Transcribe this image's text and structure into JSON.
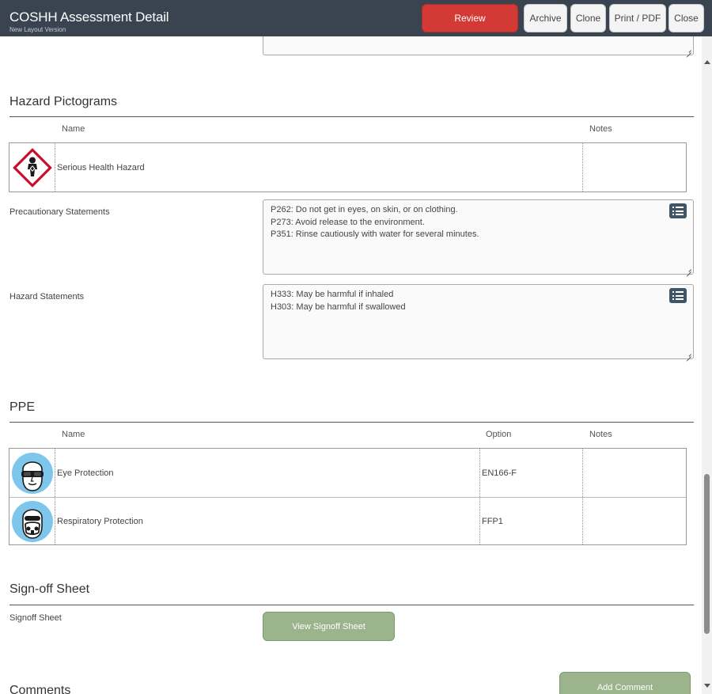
{
  "header": {
    "title": "COSHH Assessment Detail",
    "subtitle": "New Layout Version",
    "buttons": {
      "review": "Review",
      "archive": "Archive",
      "clone": "Clone",
      "print": "Print / PDF",
      "close": "Close"
    }
  },
  "hazard_pictograms": {
    "title": "Hazard Pictograms",
    "columns": {
      "name": "Name",
      "notes": "Notes"
    },
    "rows": [
      {
        "icon": "serious-health-hazard-icon",
        "name": "Serious Health Hazard",
        "notes": ""
      }
    ]
  },
  "precautionary": {
    "label": "Precautionary Statements",
    "lines": [
      "P262: Do not get in eyes, on skin, or on clothing.",
      "P273: Avoid release to the environment.",
      "P351: Rinse cautiously with water for several minutes."
    ]
  },
  "hazard_statements": {
    "label": "Hazard Statements",
    "lines": [
      "H333: May be harmful if inhaled",
      "H303: May be harmful if swallowed"
    ]
  },
  "ppe": {
    "title": "PPE",
    "columns": {
      "name": "Name",
      "option": "Option",
      "notes": "Notes"
    },
    "rows": [
      {
        "icon": "eye-protection-icon",
        "name": "Eye Protection",
        "option": "EN166-F",
        "notes": ""
      },
      {
        "icon": "respiratory-protection-icon",
        "name": "Respiratory Protection",
        "option": "FFP1",
        "notes": ""
      }
    ]
  },
  "signoff": {
    "title": "Sign-off Sheet",
    "label": "Signoff Sheet",
    "button": "View Signoff Sheet"
  },
  "comments": {
    "title": "Comments",
    "button": "Add Comment"
  },
  "colors": {
    "header_bg": "#3a4450",
    "review_button": "#d43a35",
    "green_button": "#9bb48c",
    "ppe_icon_bg": "#7fc6ec",
    "hazard_red": "#c8102e"
  }
}
